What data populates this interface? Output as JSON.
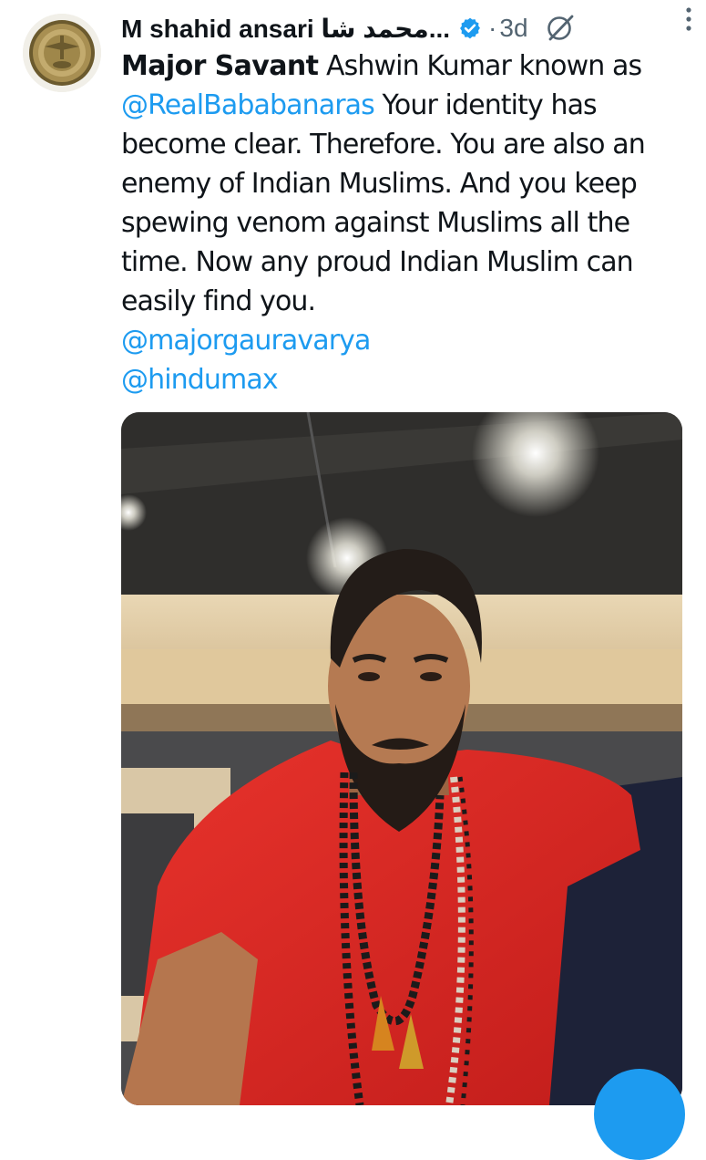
{
  "tweet": {
    "display_name": "M shahid ansari محمد شا...",
    "separator": "·",
    "timestamp": "3d",
    "avatar_icon": "profile-badge-avatar",
    "verified_icon": "verified-badge-icon",
    "grok_icon": "grok-icon",
    "more_icon": "more-options-icon",
    "text": {
      "reply_to": "Major Savant",
      "line1_rest": " Ashwin Kumar known as",
      "mention_1": "@RealBababanaras",
      "line2_rest": " Your identity has",
      "line3": "become clear. Therefore. You are also an",
      "line4": "enemy of Indian Muslims. And you keep",
      "line5": "spewing venom against Muslims all the",
      "line6": "time. Now any proud Indian Muslim can",
      "line7": "easily find you.",
      "mention_2": "@majorgauravarya",
      "mention_3": "@hindumax"
    },
    "media": {
      "kind": "photo",
      "icon": "photo-man-in-red-tshirt"
    },
    "colors": {
      "link": "#1d9bf0",
      "text": "#0f1419",
      "muted": "#536471",
      "verified": "#1d9bf0"
    }
  }
}
